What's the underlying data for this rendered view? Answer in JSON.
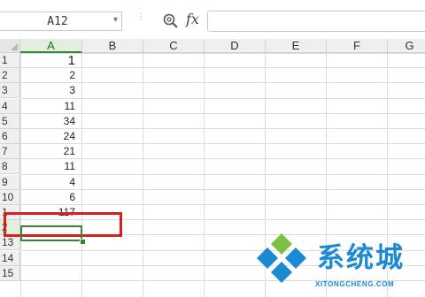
{
  "formula_bar": {
    "name_box": "A12",
    "fx_label": "fx",
    "formula_value": ""
  },
  "columns": [
    "A",
    "B",
    "C",
    "D",
    "E",
    "F",
    "G"
  ],
  "active_column": "A",
  "rows": [
    "1",
    "2",
    "3",
    "4",
    "5",
    "6",
    "7",
    "8",
    "9",
    "10",
    "1",
    "2",
    "13",
    "14",
    "15"
  ],
  "cells": [
    {
      "row": 1,
      "col": "A",
      "value": "1"
    },
    {
      "row": 2,
      "col": "A",
      "value": "2"
    },
    {
      "row": 3,
      "col": "A",
      "value": "3"
    },
    {
      "row": 4,
      "col": "A",
      "value": "11"
    },
    {
      "row": 5,
      "col": "A",
      "value": "34"
    },
    {
      "row": 6,
      "col": "A",
      "value": "24"
    },
    {
      "row": 7,
      "col": "A",
      "value": "21"
    },
    {
      "row": 8,
      "col": "A",
      "value": "11"
    },
    {
      "row": 9,
      "col": "A",
      "value": "4"
    },
    {
      "row": 10,
      "col": "A",
      "value": "6"
    },
    {
      "row": 11,
      "col": "A",
      "value": "117"
    }
  ],
  "selected_cell": "A12",
  "highlight": {
    "target_row": 11,
    "color": "#d81f1f"
  },
  "accent_color": "#2e8a2e",
  "watermark": {
    "title": "系统城",
    "domain": "XITONGCHENG.COM",
    "color": "#1b8ad3"
  },
  "icons": {
    "zoom": "zoom-search-icon",
    "function": "fx-icon",
    "dropdown": "chevron-down-icon"
  }
}
